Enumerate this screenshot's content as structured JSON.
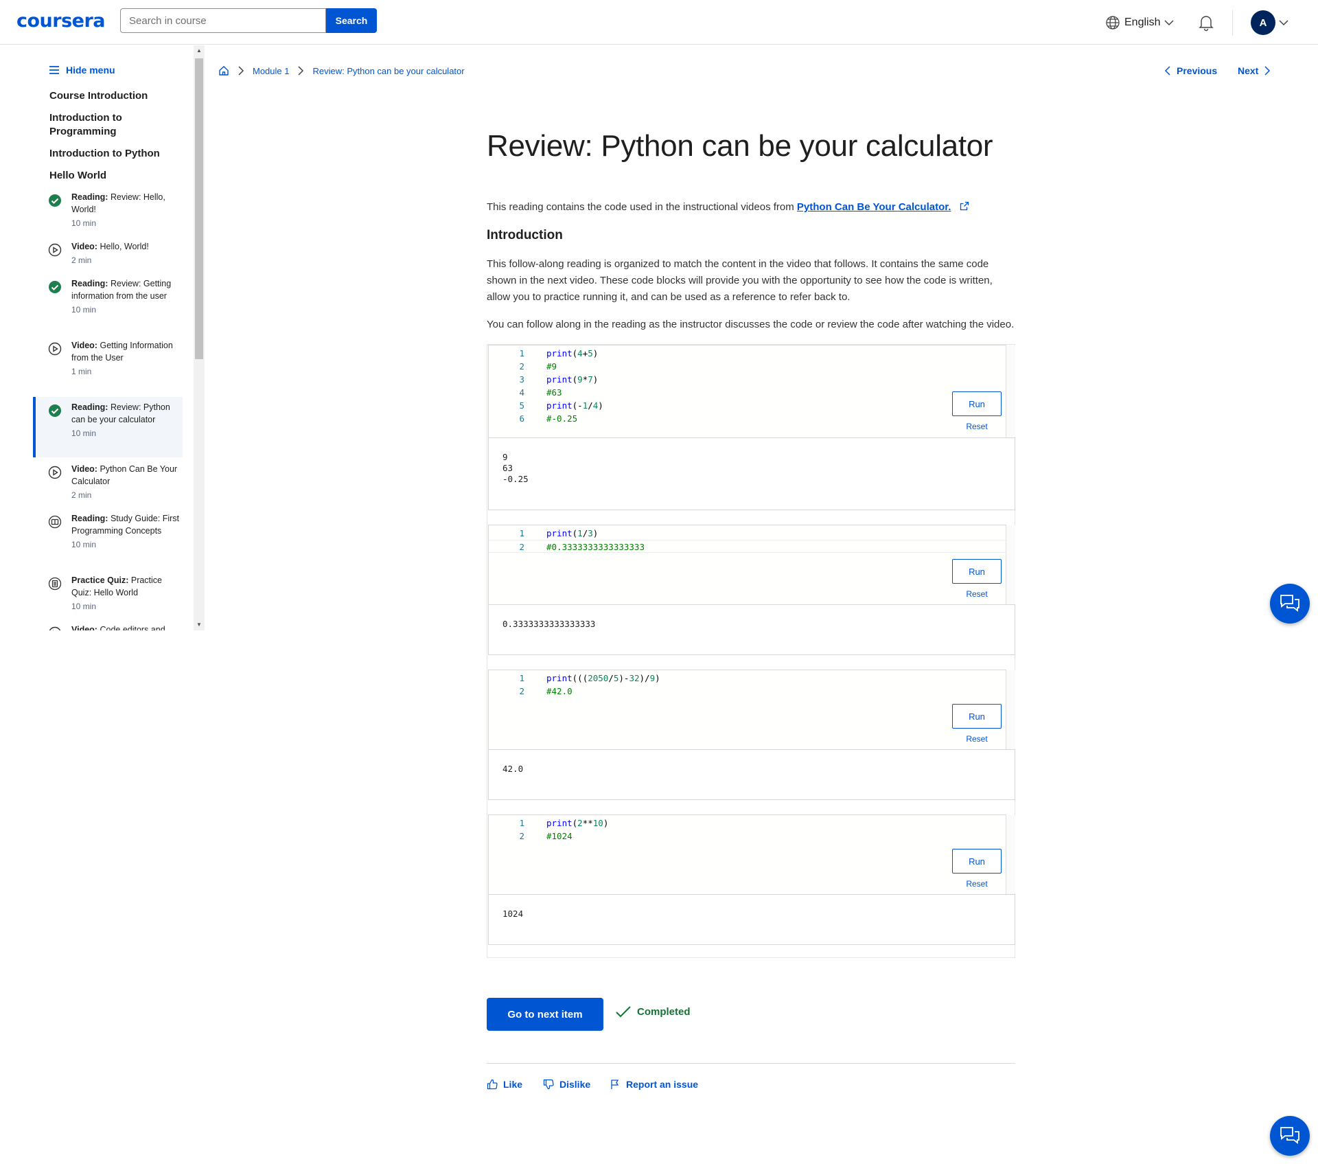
{
  "header": {
    "logo": "coursera",
    "search_placeholder": "Search in course",
    "search_button": "Search",
    "language": "English",
    "avatar_initial": "A"
  },
  "sidebar": {
    "hide_menu": "Hide menu",
    "sections": [
      "Course Introduction",
      "Introduction to Programming",
      "Introduction to Python",
      "Hello World"
    ],
    "items": [
      {
        "type": "Reading:",
        "title": "Review: Hello, World!",
        "duration": "10 min",
        "icon": "check-circle-icon",
        "completed": true
      },
      {
        "type": "Video:",
        "title": "Hello, World!",
        "duration": "2 min",
        "icon": "play-circle-icon",
        "completed": false
      },
      {
        "type": "Reading:",
        "title": "Review: Getting information from the user",
        "duration": "10 min",
        "icon": "check-circle-icon",
        "completed": true
      },
      {
        "type": "Video:",
        "title": "Getting Information from the User",
        "duration": "1 min",
        "icon": "play-circle-icon",
        "completed": false
      },
      {
        "type": "Reading:",
        "title": "Review: Python can be your calculator",
        "duration": "10 min",
        "icon": "check-circle-icon",
        "completed": true,
        "active": true
      },
      {
        "type": "Video:",
        "title": "Python Can Be Your Calculator",
        "duration": "2 min",
        "icon": "play-circle-icon",
        "completed": false
      },
      {
        "type": "Reading:",
        "title": "Study Guide: First Programming Concepts",
        "duration": "10 min",
        "icon": "book-icon",
        "completed": false
      },
      {
        "type": "Practice Quiz:",
        "title": "Practice Quiz: Hello World",
        "duration": "10 min",
        "icon": "quiz-icon",
        "completed": false
      },
      {
        "type": "Video:",
        "title": "Code editors and",
        "duration": "",
        "icon": "play-circle-icon",
        "completed": false
      }
    ]
  },
  "breadcrumb": {
    "module": "Module 1",
    "current": "Review: Python can be your calculator"
  },
  "nav": {
    "previous": "Previous",
    "next": "Next"
  },
  "main": {
    "title": "Review: Python can be your calculator",
    "intro_text": "This reading contains the code used in the instructional videos from ",
    "intro_link": "Python Can Be Your Calculator.",
    "section_heading": "Introduction",
    "para1": "This follow-along reading is organized to match the content in the video that follows. It contains the same code shown in the next video.  These code blocks will provide you with the opportunity to see how the code is written, allow you to practice running it, and can be used as a reference to refer back to.",
    "para2": "You can follow along in the reading as the instructor discusses the code or review the code after watching the video."
  },
  "code_blocks": [
    {
      "lines": [
        {
          "n": "1",
          "code": "print(4+5)"
        },
        {
          "n": "2",
          "code": "#9"
        },
        {
          "n": "3",
          "code": "print(9*7)"
        },
        {
          "n": "4",
          "code": "#63"
        },
        {
          "n": "5",
          "code": "print(-1/4)"
        },
        {
          "n": "6",
          "code": "#-0.25"
        }
      ],
      "output": "9\n63\n-0.25"
    },
    {
      "lines": [
        {
          "n": "1",
          "code": "print(1/3)"
        },
        {
          "n": "2",
          "code": "#0.3333333333333333"
        }
      ],
      "output": "0.3333333333333333"
    },
    {
      "lines": [
        {
          "n": "1",
          "code": "print(((2050/5)-32)/9)"
        },
        {
          "n": "2",
          "code": "#42.0"
        }
      ],
      "output": "42.0"
    },
    {
      "lines": [
        {
          "n": "1",
          "code": "print(2**10)"
        },
        {
          "n": "2",
          "code": "#1024"
        }
      ],
      "output": "1024"
    }
  ],
  "buttons": {
    "run": "Run",
    "reset": "Reset",
    "go_next": "Go to next item",
    "completed": "Completed"
  },
  "feedback": {
    "like": "Like",
    "dislike": "Dislike",
    "report": "Report an issue"
  },
  "colors": {
    "brand": "#0056d2",
    "success": "#137333"
  }
}
